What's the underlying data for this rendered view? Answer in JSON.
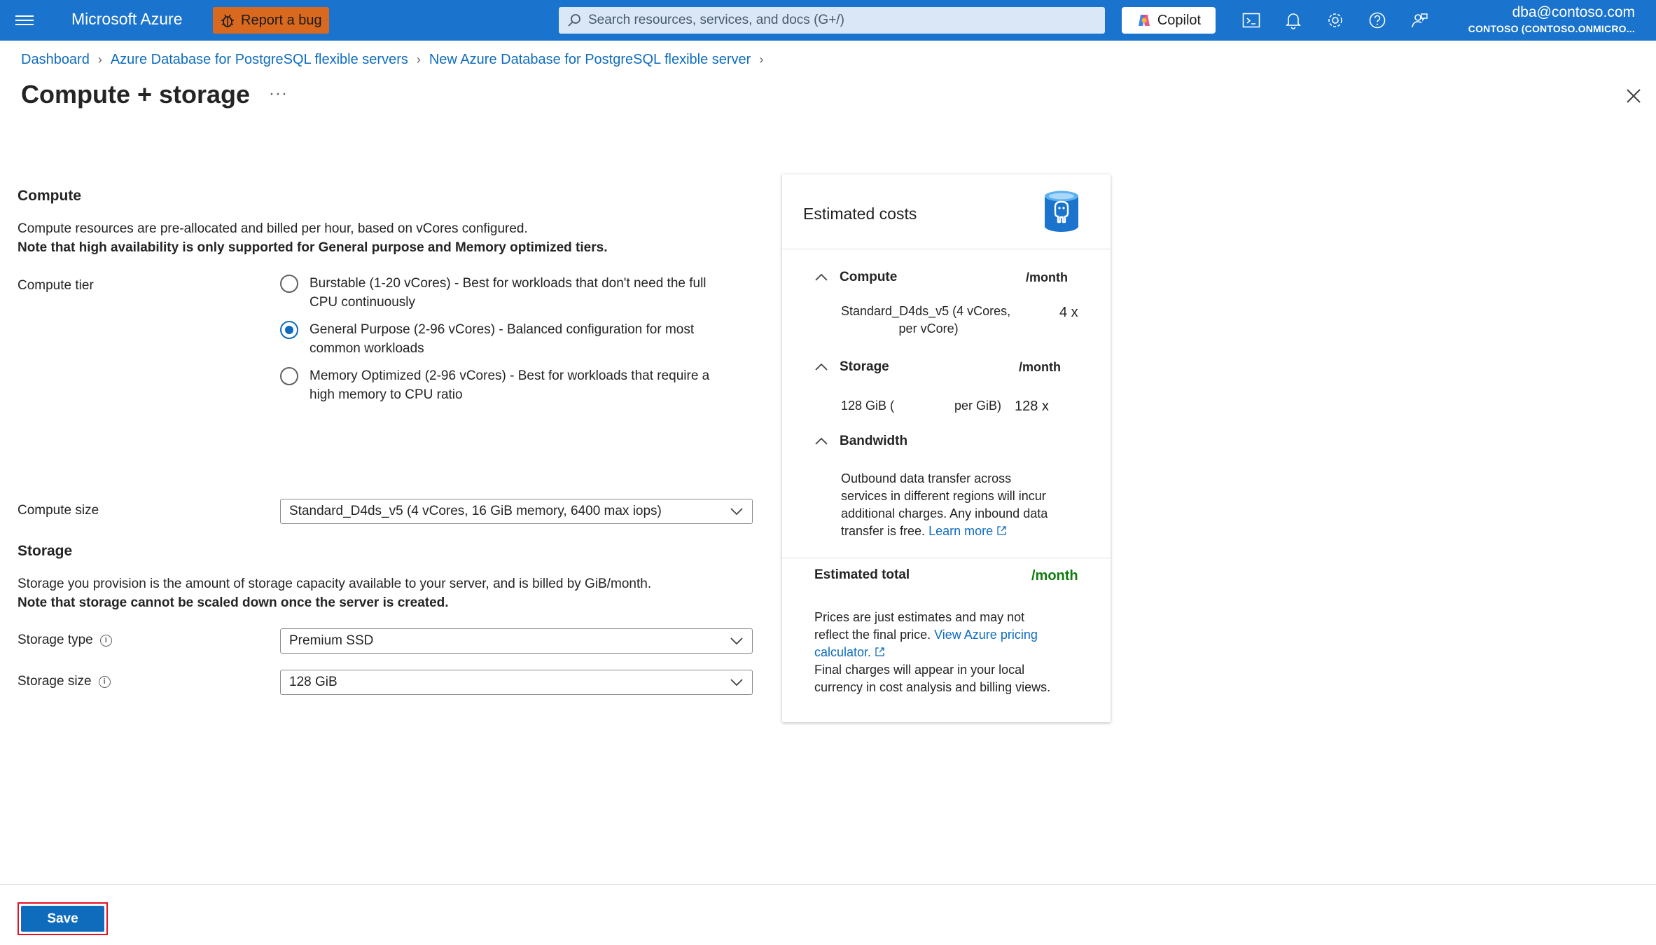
{
  "topbar": {
    "brand": "Microsoft Azure",
    "report_bug_label": "Report a bug",
    "search_placeholder": "Search resources, services, and docs (G+/)",
    "copilot_label": "Copilot",
    "account_email": "dba@contoso.com",
    "account_tenant": "CONTOSO (CONTOSO.ONMICRO..."
  },
  "breadcrumb": [
    "Dashboard",
    "Azure Database for PostgreSQL flexible servers",
    "New Azure Database for PostgreSQL flexible server"
  ],
  "page": {
    "title": "Compute + storage",
    "more": "···"
  },
  "compute": {
    "heading": "Compute",
    "desc_line1": "Compute resources are pre-allocated and billed per hour, based on vCores configured.",
    "desc_line2": "Note that high availability is only supported for General purpose and Memory optimized tiers.",
    "tier_label": "Compute tier",
    "tiers": [
      {
        "line1": "Burstable (1-20 vCores) - Best for workloads that don't need the full",
        "line2": "CPU continuously",
        "selected": false
      },
      {
        "line1": "General Purpose (2-96 vCores) - Balanced configuration for most",
        "line2": "common workloads",
        "selected": true
      },
      {
        "line1": "Memory Optimized (2-96 vCores) - Best for workloads that require a",
        "line2": "high memory to CPU ratio",
        "selected": false
      }
    ],
    "size_label": "Compute size",
    "size_value": "Standard_D4ds_v5 (4 vCores, 16 GiB memory, 6400 max iops)"
  },
  "storage": {
    "heading": "Storage",
    "desc_line1": "Storage you provision is the amount of storage capacity available to your server, and is billed by GiB/month.",
    "desc_line2": "Note that storage cannot be scaled down once the server is created.",
    "type_label": "Storage type",
    "type_value": "Premium SSD",
    "size_label": "Storage size",
    "size_value": "128 GiB"
  },
  "costs": {
    "title": "Estimated costs",
    "compute": {
      "label": "Compute",
      "per_month": "/month",
      "detail_line1": "Standard_D4ds_v5 (4 vCores,",
      "detail_line2": "per vCore)",
      "multiplier": "4 x"
    },
    "storage": {
      "label": "Storage",
      "per_month": "/month",
      "detail_left": "128 GiB (",
      "detail_right": "per GiB)",
      "multiplier": "128 x"
    },
    "bandwidth": {
      "label": "Bandwidth",
      "line1": "Outbound data transfer across",
      "line2": "services in different regions will incur",
      "line3": "additional charges. Any inbound data",
      "line4": "transfer is free.",
      "learn_more": "Learn more"
    },
    "total_label": "Estimated total",
    "total_per_month": "/month",
    "note_line1": "Prices are just estimates and may not",
    "note_line2": "reflect the final price.",
    "pricing_link_1": "View Azure pricing",
    "pricing_link_2": "calculator.",
    "note_line3": "Final charges will appear in your local",
    "note_line4": "currency in cost analysis and billing views."
  },
  "footer": {
    "save_label": "Save"
  },
  "colors": {
    "topbar": "#1a73cc",
    "primary": "#0f6cbd",
    "bug": "#d9691f",
    "total_green": "#107c10",
    "save_outline": "#e81123"
  }
}
